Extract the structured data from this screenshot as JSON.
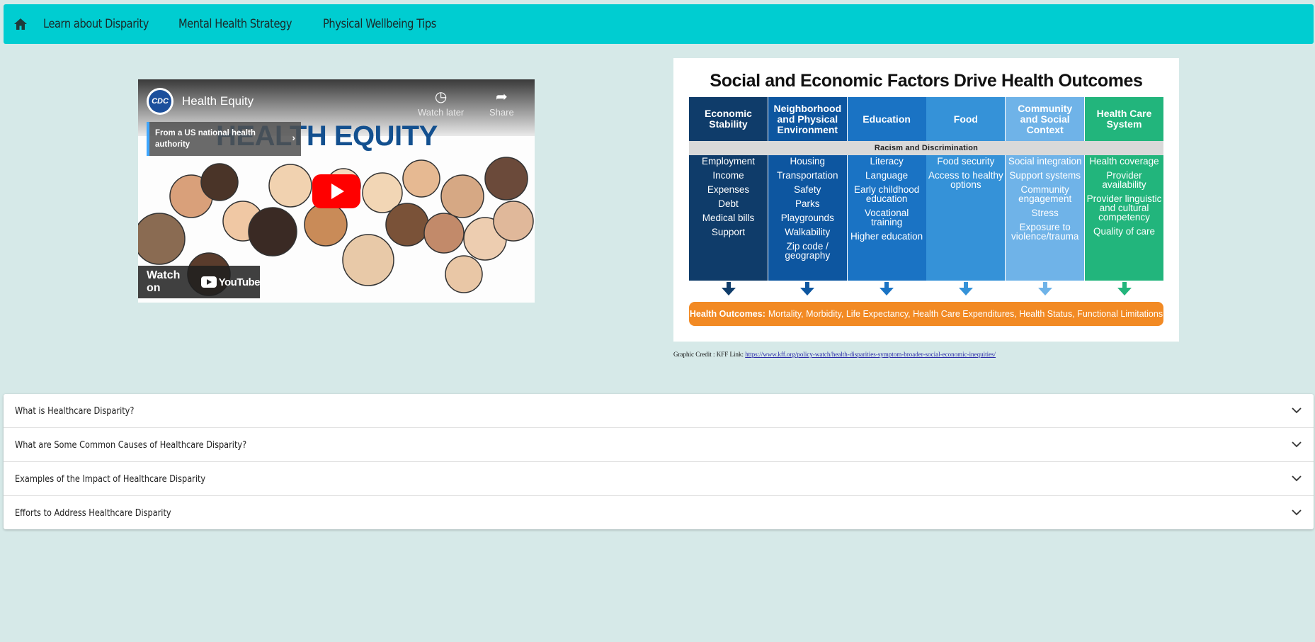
{
  "nav": {
    "home_icon": "home-icon",
    "links": [
      "Learn about Disparity",
      "Mental Health Strategy",
      "Physical Wellbeing Tips"
    ]
  },
  "video": {
    "channel_logo_text": "CDC",
    "title": "Health Equity",
    "watch_later": "Watch later",
    "share": "Share",
    "authority": "From a US national health authority",
    "heading": "HEALTH EQUITY",
    "watch_on": "Watch on",
    "youtube": "YouTube"
  },
  "infographic": {
    "title": "Social and Economic Factors Drive Health Outcomes",
    "racism_bar": "Racism and Discrimination",
    "columns": [
      {
        "header": "Economic Stability",
        "color": "#0f3c6a",
        "items": [
          "Employment",
          "Income",
          "Expenses",
          "Debt",
          "Medical bills",
          "Support"
        ]
      },
      {
        "header": "Neighborhood and Physical Environment",
        "color": "#0d56a0",
        "items": [
          "Housing",
          "Transportation",
          "Safety",
          "Parks",
          "Playgrounds",
          "Walkability",
          "Zip code / geography"
        ]
      },
      {
        "header": "Education",
        "color": "#1a73c4",
        "items": [
          "Literacy",
          "Language",
          "Early childhood education",
          "Vocational training",
          "Higher education"
        ]
      },
      {
        "header": "Food",
        "color": "#3592d8",
        "items": [
          "Food security",
          "Access to healthy options"
        ]
      },
      {
        "header": "Community and Social Context",
        "color": "#6fb3e8",
        "items": [
          "Social integration",
          "Support systems",
          "Community engagement",
          "Stress",
          "Exposure to violence/trauma"
        ]
      },
      {
        "header": "Health Care System",
        "color": "#22b57c",
        "items": [
          "Health coverage",
          "Provider availability",
          "Provider linguistic and cultural competency",
          "Quality of care"
        ]
      }
    ],
    "outcomes_label": "Health Outcomes:",
    "outcomes_text": "Mortality, Morbidity, Life Expectancy, Health Care Expenditures, Health Status, Functional Limitations"
  },
  "credit": {
    "text": "Graphic Credit : KFF Link: ",
    "link": "https://www.kff.org/policy-watch/health-disparities-symptom-broader-social-economic-inequities/"
  },
  "accordion": [
    "What is Healthcare Disparity?",
    "What are Some Common Causes of Healthcare Disparity?",
    "Examples of the Impact of Healthcare Disparity",
    "Efforts to Address Healthcare Disparity"
  ]
}
